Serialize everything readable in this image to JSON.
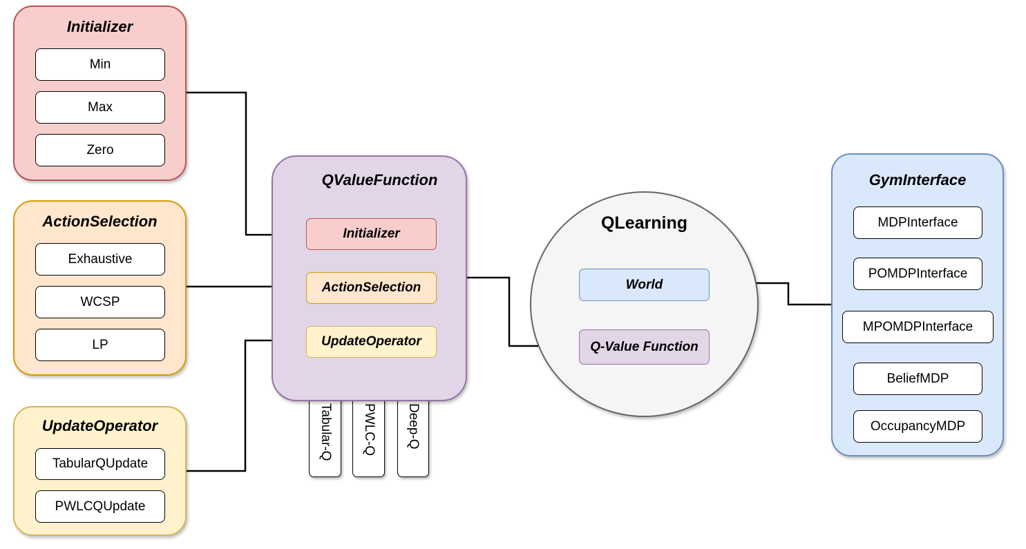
{
  "colors": {
    "initializer_fill": "#f8cecc",
    "initializer_stroke": "#b85450",
    "action_fill": "#ffe6cc",
    "action_stroke": "#d79b00",
    "update_fill": "#fff2cc",
    "update_stroke": "#d6b656",
    "qvalue_fill": "#e1d5e7",
    "qvalue_stroke": "#9673a6",
    "gym_fill": "#dae8fc",
    "gym_stroke": "#6c8ebf",
    "qlearning_fill": "#f5f5f5",
    "qlearning_stroke": "#666666"
  },
  "initializer": {
    "title": "Initializer",
    "items": [
      "Min",
      "Max",
      "Zero"
    ]
  },
  "action_selection": {
    "title": "ActionSelection",
    "items": [
      "Exhaustive",
      "WCSP",
      "LP"
    ]
  },
  "update_operator": {
    "title": "UpdateOperator",
    "items": [
      "TabularQUpdate",
      "PWLCQUpdate"
    ]
  },
  "qvalue_function": {
    "title": "QValueFunction",
    "slots": [
      "Initializer",
      "ActionSelection",
      "UpdateOperator"
    ],
    "variants": [
      "Tabular-Q",
      "PWLC-Q",
      "Deep-Q"
    ]
  },
  "qlearning": {
    "title": "QLearning",
    "slots": [
      "World",
      "Q-Value Function"
    ]
  },
  "gym_interface": {
    "title": "GymInterface",
    "items": [
      "MDPInterface",
      "POMDPInterface",
      "MPOMDPInterface",
      "BeliefMDP",
      "OccupancyMDP"
    ]
  }
}
